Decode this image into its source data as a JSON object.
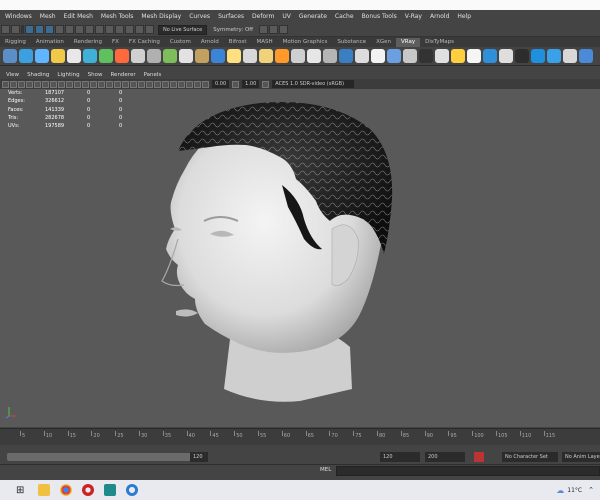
{
  "menubar": {
    "items": [
      "Windows",
      "Mesh",
      "Edit Mesh",
      "Mesh Tools",
      "Mesh Display",
      "Curves",
      "Surfaces",
      "Deform",
      "UV",
      "Generate",
      "Cache",
      "Bonus Tools",
      "V-Ray",
      "Arnold",
      "Help"
    ]
  },
  "status_line": {
    "live_surface": "No Live Surface",
    "symmetry": "Symmetry: Off"
  },
  "shelf": {
    "tabs": [
      "Rigging",
      "Animation",
      "Rendering",
      "FX",
      "FX Caching",
      "Custom",
      "Arnold",
      "Bifrost",
      "MASH",
      "Motion Graphics",
      "Substance",
      "XGen",
      "VRay",
      "DisTyMaps"
    ],
    "active_tab": "VRay",
    "icon_colors": [
      "#5b8fc7",
      "#3aa0e0",
      "#5fb6ff",
      "#f0c94a",
      "#e8e8e8",
      "#3fb0d8",
      "#60c060",
      "#ff6a3d",
      "#d0d0d0",
      "#b0b0b0",
      "#7dbd5a",
      "#e2e2e2",
      "#c2a060",
      "#3c84d6",
      "#ffe080",
      "#d8d8d8",
      "#efd27a",
      "#ff9a2a",
      "#cfcfcf",
      "#e6e6e6",
      "#b5b5b5",
      "#3a7fc2",
      "#dcdcdc",
      "#f2f2f2",
      "#6aa0e0",
      "#c8c8c8",
      "#333",
      "#e0e0e0",
      "#ffcf3f",
      "#f5f5f5",
      "#2f8fd8",
      "#dedede",
      "#2d2d2d",
      "#1f8fe0",
      "#3aa0e8",
      "#d8d8d8",
      "#4a8ad8"
    ]
  },
  "panel": {
    "menu": [
      "View",
      "Shading",
      "Lighting",
      "Show",
      "Renderer",
      "Panels"
    ],
    "exposure": "0.00",
    "gamma": "1.00",
    "colorspace": "ACES 1.0 SDR-video (sRGB)"
  },
  "hud": {
    "rows": [
      {
        "label": "Verts:",
        "a": "187107",
        "b": "0",
        "c": "0"
      },
      {
        "label": "Edges:",
        "a": "326612",
        "b": "0",
        "c": "0"
      },
      {
        "label": "Faces:",
        "a": "141339",
        "b": "0",
        "c": "0"
      },
      {
        "label": "Tris:",
        "a": "282678",
        "b": "0",
        "c": "0"
      },
      {
        "label": "UVs:",
        "a": "197589",
        "b": "0",
        "c": "0"
      }
    ]
  },
  "time_slider": {
    "ticks": [
      "5",
      "10",
      "15",
      "20",
      "25",
      "30",
      "35",
      "40",
      "45",
      "50",
      "55",
      "60",
      "65",
      "70",
      "75",
      "80",
      "85",
      "90",
      "95",
      "100",
      "105",
      "110",
      "115"
    ]
  },
  "range_slider": {
    "range_end_inner": "120",
    "end_time": "120",
    "anim_end": "200",
    "character_set": "No Character Set",
    "anim_layer": "No Anim Layer"
  },
  "command_line": {
    "label": "MEL"
  },
  "taskbar": {
    "weather": "11°C",
    "icon_colors": [
      "#1a1a1a",
      "#f0c040",
      "#dd4433",
      "#cc2222",
      "#1e8a8a",
      "#2a7bd5"
    ]
  },
  "colors": {
    "viewport_bg": "#595959",
    "ui_bg": "#444444",
    "active_tab": "#5d5d5d",
    "accent_blue": "#3d6c93"
  }
}
